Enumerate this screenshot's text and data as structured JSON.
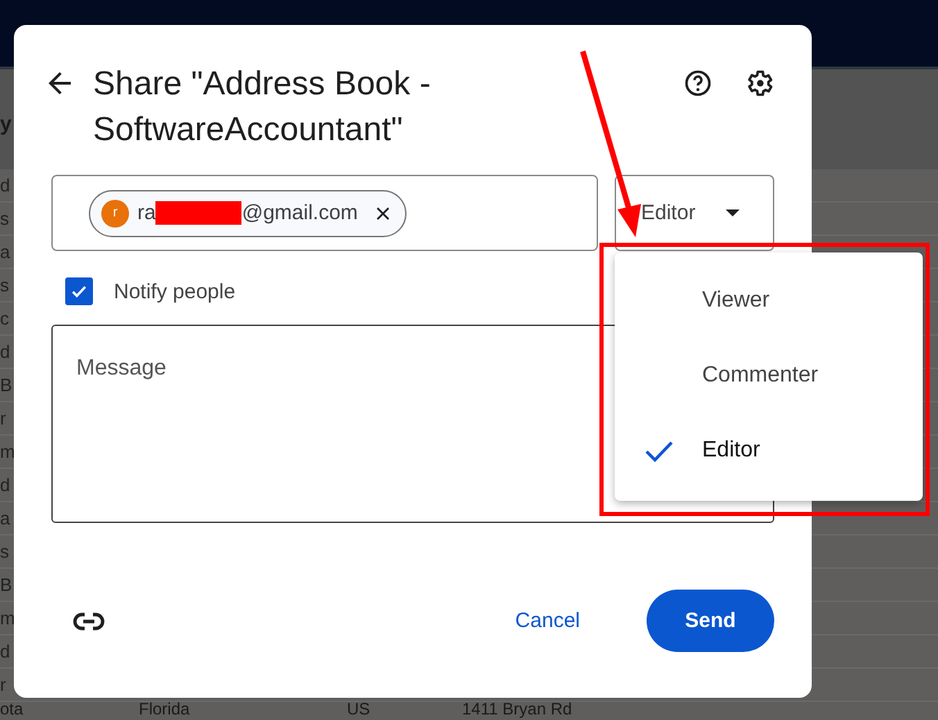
{
  "backdrop": {
    "header_text": "y",
    "column_fragments": [
      "d",
      "s",
      "a",
      "s",
      "c",
      "d",
      "B",
      "r",
      "m",
      "d",
      "a",
      "s",
      "B",
      "m",
      "d",
      "r"
    ],
    "bottom_row": [
      "ota",
      "Florida",
      "US",
      "1411 Bryan Rd"
    ]
  },
  "dialog": {
    "title": "Share \"Address Book - SoftwareAccountant\"",
    "recipient": {
      "avatar_letter": "r",
      "email_start": "ra",
      "email_end": "@gmail.com",
      "redacted": true
    },
    "role": "Editor",
    "notify": {
      "label": "Notify people",
      "checked": true
    },
    "message": {
      "placeholder": "Message"
    },
    "buttons": {
      "cancel": "Cancel",
      "send": "Send"
    }
  },
  "role_menu": [
    {
      "label": "Viewer",
      "selected": false
    },
    {
      "label": "Commenter",
      "selected": false
    },
    {
      "label": "Editor",
      "selected": true
    }
  ],
  "annotation": {
    "arrow": true,
    "highlight": true
  }
}
